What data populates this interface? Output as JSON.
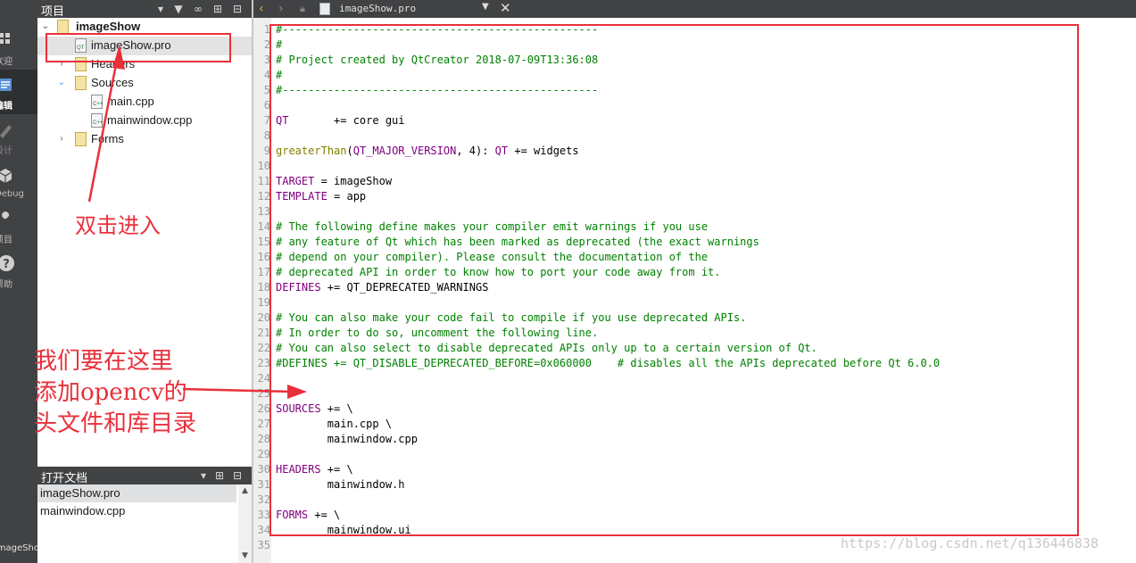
{
  "mode_bar": {
    "items": [
      {
        "label": "欢迎",
        "icon": "grid-icon"
      },
      {
        "label": "编辑",
        "icon": "document-icon",
        "active": true
      },
      {
        "label": "设计",
        "icon": "pencil-icon"
      },
      {
        "label": "Debug",
        "icon": "bug-icon"
      },
      {
        "label": "项目",
        "icon": "wrench-icon"
      },
      {
        "label": "帮助",
        "icon": "help-icon"
      }
    ],
    "bottom_label": "imageShow"
  },
  "project_panel": {
    "title": "项目",
    "tree": [
      {
        "label": "imageShow",
        "level": 0,
        "expanded": true,
        "bold": true
      },
      {
        "label": "imageShow.pro",
        "level": 1,
        "selected": true
      },
      {
        "label": "Headers",
        "level": 1,
        "expanded": false
      },
      {
        "label": "Sources",
        "level": 1,
        "expanded": true
      },
      {
        "label": "main.cpp",
        "level": 2
      },
      {
        "label": "mainwindow.cpp",
        "level": 2
      },
      {
        "label": "Forms",
        "level": 1,
        "expanded": false
      }
    ]
  },
  "open_documents": {
    "title": "打开文档",
    "items": [
      {
        "label": "imageShow.pro",
        "selected": true
      },
      {
        "label": "mainwindow.cpp"
      }
    ]
  },
  "editor_toolbar": {
    "filename": "imageShow.pro"
  },
  "editor": {
    "lines": [
      {
        "n": "1",
        "t": "#-------------------------------------------------",
        "k": "comment"
      },
      {
        "n": "2",
        "t": "#",
        "k": "comment"
      },
      {
        "n": "3",
        "t": "# Project created by QtCreator 2018-07-09T13:36:08",
        "k": "comment"
      },
      {
        "n": "4",
        "t": "#",
        "k": "comment"
      },
      {
        "n": "5",
        "t": "#-------------------------------------------------",
        "k": "comment"
      },
      {
        "n": "6",
        "t": "",
        "k": "plain"
      },
      {
        "n": "7",
        "parts": [
          {
            "t": "QT",
            "k": "var"
          },
          {
            "t": "       += core gui",
            "k": "plain"
          }
        ]
      },
      {
        "n": "8",
        "t": "",
        "k": "plain"
      },
      {
        "n": "9",
        "parts": [
          {
            "t": "greaterThan",
            "k": "fn"
          },
          {
            "t": "(",
            "k": "plain"
          },
          {
            "t": "QT_MAJOR_VERSION",
            "k": "var"
          },
          {
            "t": ", 4): ",
            "k": "plain"
          },
          {
            "t": "QT",
            "k": "var"
          },
          {
            "t": " += widgets",
            "k": "plain"
          }
        ]
      },
      {
        "n": "10",
        "t": "",
        "k": "plain"
      },
      {
        "n": "11",
        "parts": [
          {
            "t": "TARGET",
            "k": "var"
          },
          {
            "t": " = imageShow",
            "k": "plain"
          }
        ]
      },
      {
        "n": "12",
        "parts": [
          {
            "t": "TEMPLATE",
            "k": "var"
          },
          {
            "t": " = app",
            "k": "plain"
          }
        ]
      },
      {
        "n": "13",
        "t": "",
        "k": "plain"
      },
      {
        "n": "14",
        "t": "# The following define makes your compiler emit warnings if you use",
        "k": "comment"
      },
      {
        "n": "15",
        "t": "# any feature of Qt which has been marked as deprecated (the exact warnings",
        "k": "comment"
      },
      {
        "n": "16",
        "t": "# depend on your compiler). Please consult the documentation of the",
        "k": "comment"
      },
      {
        "n": "17",
        "t": "# deprecated API in order to know how to port your code away from it.",
        "k": "comment"
      },
      {
        "n": "18",
        "parts": [
          {
            "t": "DEFINES",
            "k": "var"
          },
          {
            "t": " += QT_DEPRECATED_WARNINGS",
            "k": "plain"
          }
        ]
      },
      {
        "n": "19",
        "t": "",
        "k": "plain"
      },
      {
        "n": "20",
        "t": "# You can also make your code fail to compile if you use deprecated APIs.",
        "k": "comment"
      },
      {
        "n": "21",
        "t": "# In order to do so, uncomment the following line.",
        "k": "comment"
      },
      {
        "n": "22",
        "t": "# You can also select to disable deprecated APIs only up to a certain version of Qt.",
        "k": "comment"
      },
      {
        "n": "23",
        "t": "#DEFINES += QT_DISABLE_DEPRECATED_BEFORE=0x060000    # disables all the APIs deprecated before Qt 6.0.0",
        "k": "comment"
      },
      {
        "n": "24",
        "t": "",
        "k": "plain"
      },
      {
        "n": "25",
        "t": "",
        "k": "plain"
      },
      {
        "n": "26",
        "parts": [
          {
            "t": "SOURCES",
            "k": "var"
          },
          {
            "t": " += \\",
            "k": "plain"
          }
        ]
      },
      {
        "n": "27",
        "t": "        main.cpp \\",
        "k": "plain"
      },
      {
        "n": "28",
        "t": "        mainwindow.cpp",
        "k": "plain"
      },
      {
        "n": "29",
        "t": "",
        "k": "plain"
      },
      {
        "n": "30",
        "parts": [
          {
            "t": "HEADERS",
            "k": "var"
          },
          {
            "t": " += \\",
            "k": "plain"
          }
        ]
      },
      {
        "n": "31",
        "t": "        mainwindow.h",
        "k": "plain"
      },
      {
        "n": "32",
        "t": "",
        "k": "plain"
      },
      {
        "n": "33",
        "parts": [
          {
            "t": "FORMS",
            "k": "var"
          },
          {
            "t": " += \\",
            "k": "plain"
          }
        ]
      },
      {
        "n": "34",
        "t": "        mainwindow.ui",
        "k": "plain"
      },
      {
        "n": "35",
        "t": "",
        "k": "plain"
      }
    ]
  },
  "annotations": {
    "double_click": "双击进入",
    "add_opencv": [
      "我们要在这里",
      "添加opencv的",
      "头文件和库目录"
    ],
    "color": "#e8303a"
  },
  "watermark": "https://blog.csdn.net/q136446838",
  "colors": {
    "comment": "#008000",
    "variable": "#800080",
    "function": "#808000",
    "sidebar": "#404244"
  }
}
